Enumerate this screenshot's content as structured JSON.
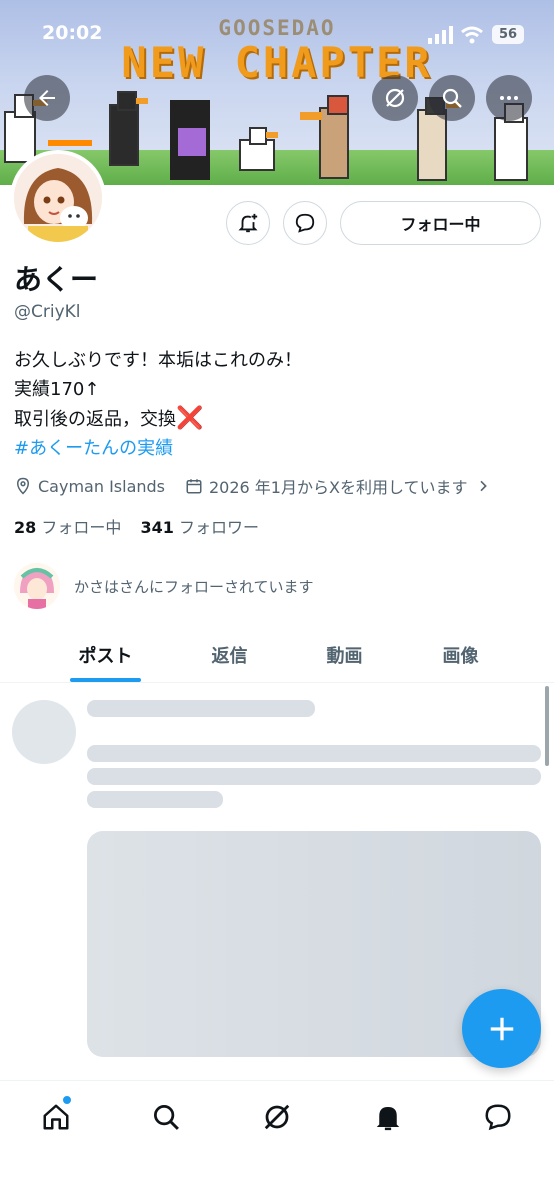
{
  "status_bar": {
    "time": "20:02",
    "battery": "56"
  },
  "banner": {
    "subtitle": "GOOSEDAO",
    "title": "NEW CHAPTER"
  },
  "profile": {
    "display_name": "あくー",
    "handle": "@CriyKl",
    "bio": [
      "お久しぶりです！本垢はこれのみ！",
      "実績170↑",
      "取引後の返品，交換"
    ],
    "bio_mark": "❌",
    "hashtag": "#あくーたんの実績",
    "location": "Cayman Islands",
    "joined": "2026 年1月からXを利用しています",
    "following_count": "28",
    "following_label": "フォロー中",
    "followers_count": "341",
    "followers_label": "フォロワー",
    "followed_by": "かさはさんにフォローされています"
  },
  "actions": {
    "follow_label": "フォロー中"
  },
  "tabs": [
    {
      "label": "ポスト",
      "active": true
    },
    {
      "label": "返信",
      "active": false
    },
    {
      "label": "動画",
      "active": false
    },
    {
      "label": "画像",
      "active": false
    }
  ],
  "colors": {
    "accent": "#1d9bf0",
    "text": "#0f1419",
    "muted": "#536471",
    "red_mark": "#e0243a"
  },
  "icons": {
    "top": [
      "back-arrow-icon",
      "grok-icon",
      "search-icon",
      "more-icon"
    ],
    "bottom_nav": [
      "home-icon",
      "search-icon",
      "grok-icon",
      "notifications-icon",
      "messages-icon"
    ]
  }
}
